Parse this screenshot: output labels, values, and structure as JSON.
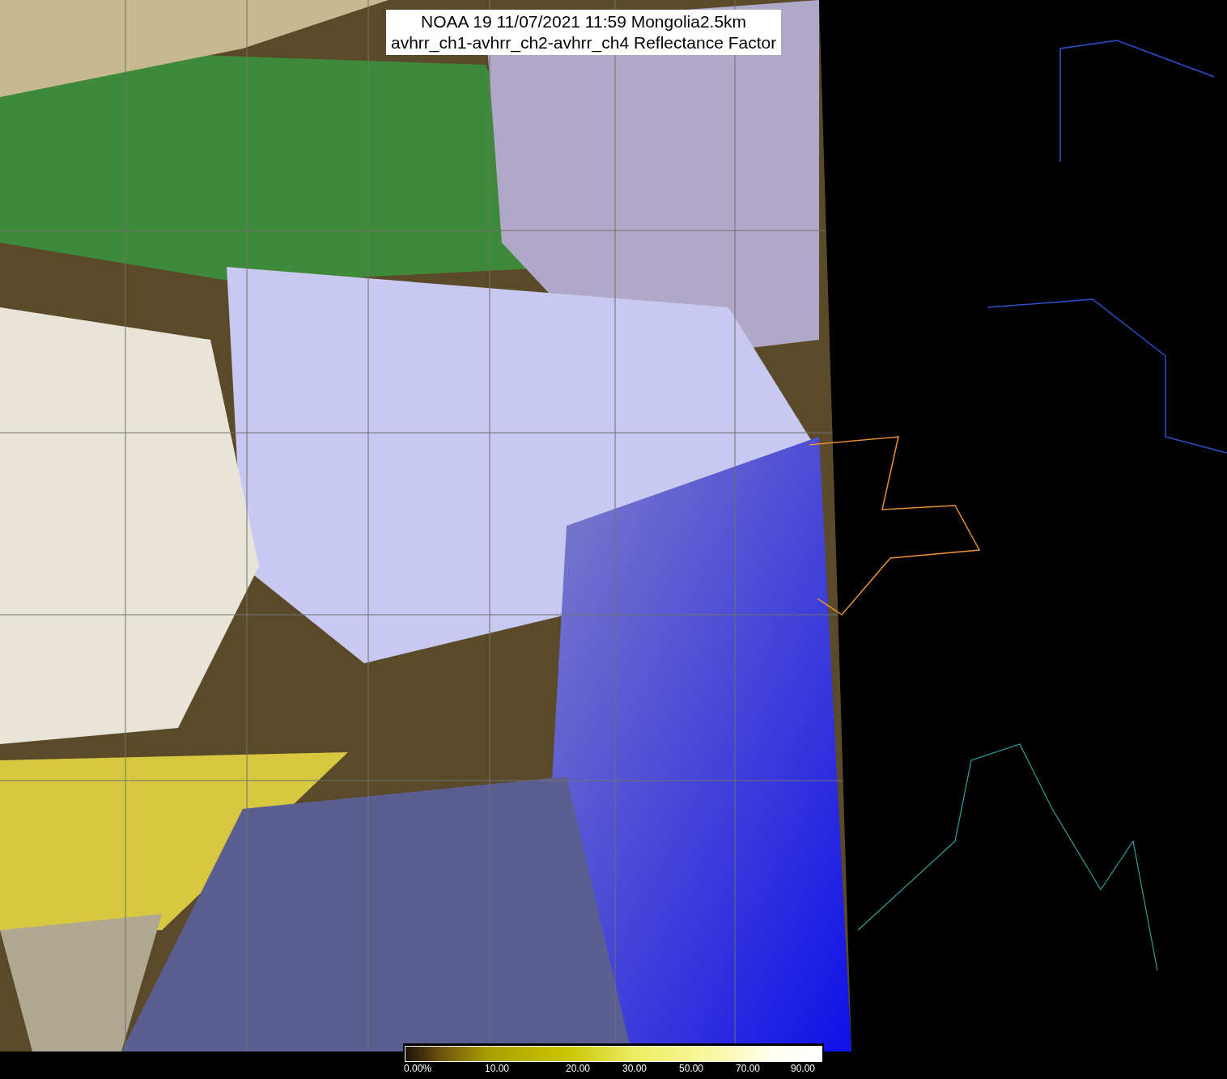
{
  "title": {
    "lines": [
      "NOAA 19 11/07/2021 11:59 Mongolia2.5km",
      "avhrr_ch1-avhrr_ch2-avhrr_ch4 Reflectance Factor"
    ]
  },
  "colorbar": {
    "ticks": [
      "0.00%",
      "10.00",
      "20.00",
      "30.00",
      "50.00",
      "70.00",
      "90.00"
    ]
  }
}
